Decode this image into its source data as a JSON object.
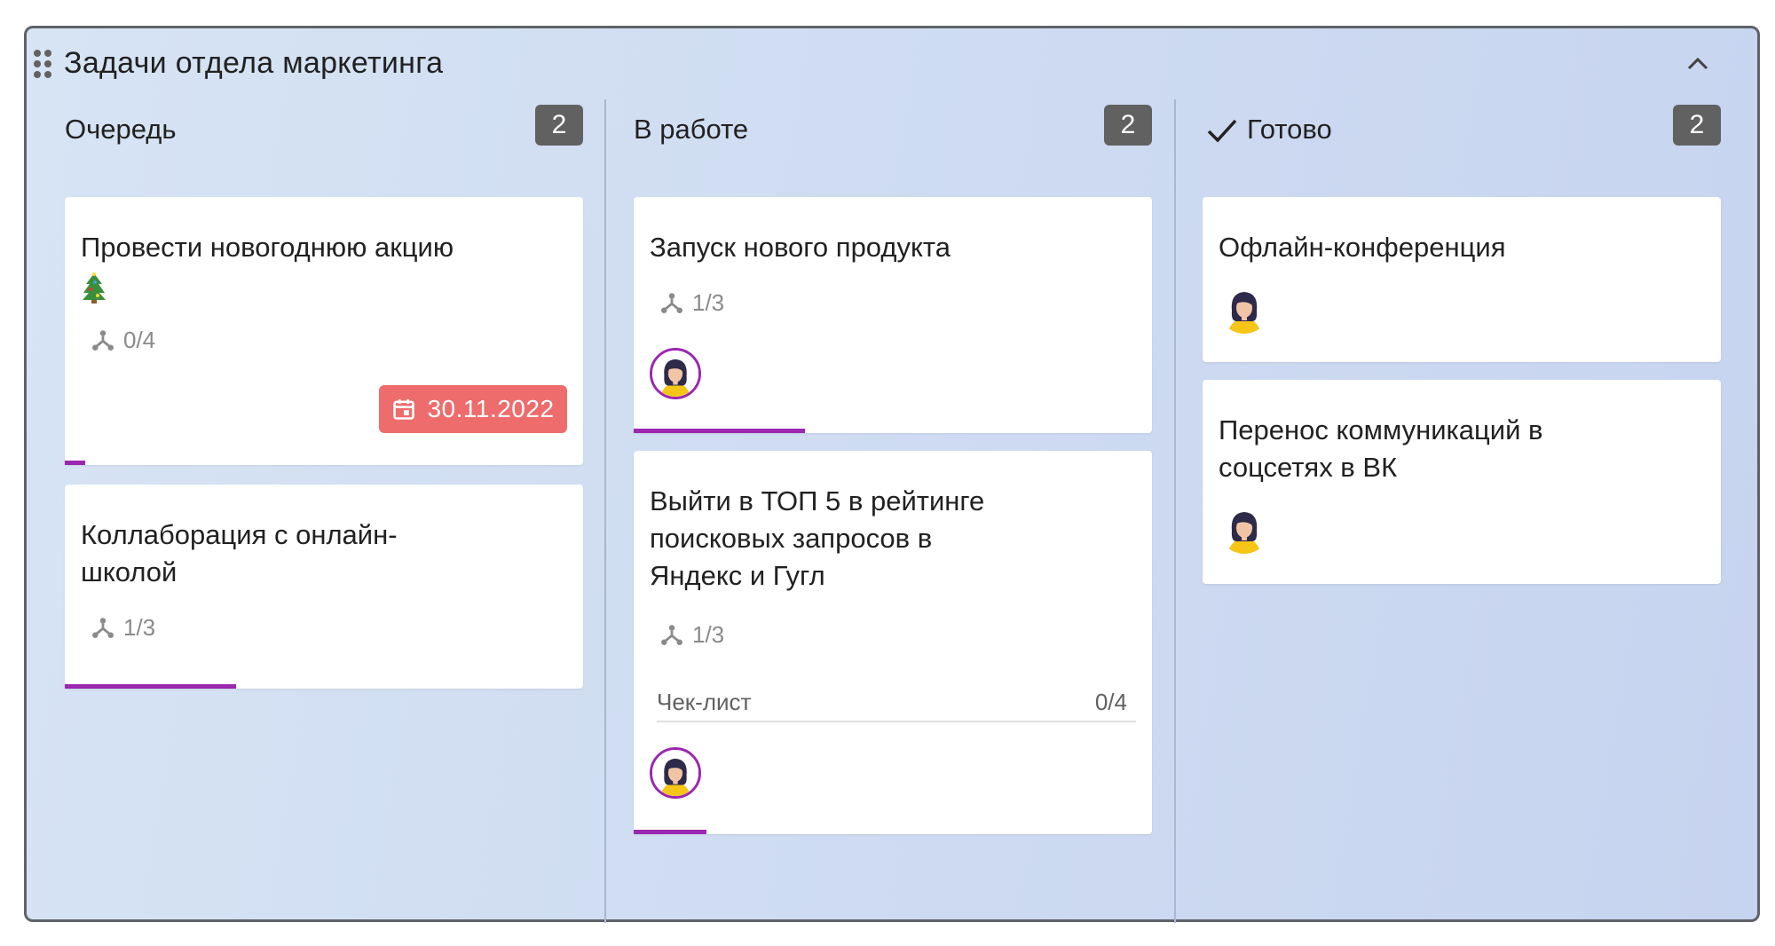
{
  "board": {
    "title": "Задачи отдела маркетинга",
    "icons": {
      "drag": "drag-handle-icon",
      "collapse": "chevron-up-icon"
    }
  },
  "columns": [
    {
      "title": "Очередь",
      "count": "2",
      "cards": [
        {
          "title": "Провести новогоднюю акцию",
          "emoji": "christmas-tree-icon",
          "subtasks": "0/4",
          "due_date": "30.11.2022",
          "progress": 0.04
        },
        {
          "title": "Коллаборация с онлайн-школой",
          "subtasks": "1/3",
          "progress": 0.33
        }
      ]
    },
    {
      "title": "В работе",
      "count": "2",
      "cards": [
        {
          "title": "Запуск нового продукта",
          "subtasks": "1/3",
          "assignee": "avatar-woman",
          "progress": 0.33
        },
        {
          "title": "Выйти в ТОП 5 в рейтинге поисковых запросов в Яндекс и Гугл",
          "subtasks": "1/3",
          "checklist_label": "Чек-лист",
          "checklist_count": "0/4",
          "assignee": "avatar-woman",
          "progress": 0.14
        }
      ]
    },
    {
      "title": "Готово",
      "count": "2",
      "done_icon": "check-icon",
      "cards": [
        {
          "title": "Офлайн-конференция",
          "assignee": "avatar-woman"
        },
        {
          "title": "Перенос коммуникаций в соцсетях в ВК",
          "assignee": "avatar-woman"
        }
      ]
    }
  ],
  "colors": {
    "progress": "#9c27b0",
    "date_badge": "#ef6c6c",
    "count_badge": "#616161"
  }
}
